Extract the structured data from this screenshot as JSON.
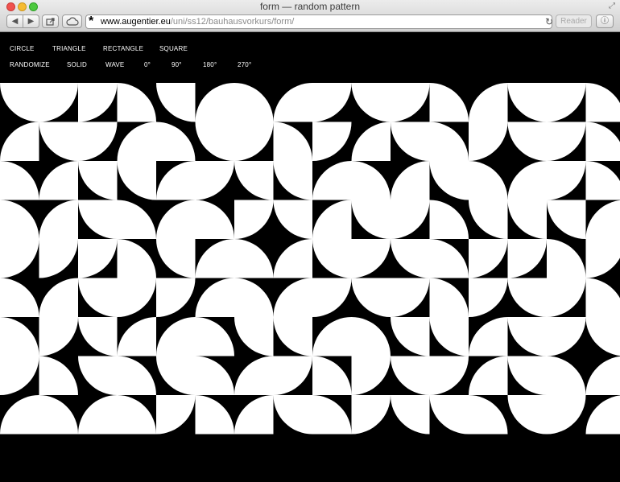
{
  "window": {
    "title": "form — random pattern"
  },
  "address_bar": {
    "host": "www.augentier.eu",
    "path": "/uni/ss12/bauhausvorkurs/form/"
  },
  "toolbar": {
    "reader_label": "Reader"
  },
  "menu": {
    "shapes": [
      "CIRCLE",
      "TRIANGLE",
      "RECTANGLE",
      "SQUARE"
    ],
    "modes": [
      "RANDOMIZE",
      "SOLID",
      "WAVE",
      "0°",
      "90°",
      "180°",
      "270°"
    ]
  },
  "pattern": {
    "colors": {
      "background": "#000000",
      "foreground": "#ffffff"
    },
    "rows": [
      "2330210132301230",
      "1231023031203230",
      "0122132210120130",
      "0120103212302221",
      "3330210123203303",
      "0123310132303230",
      "0321102210221232",
      "3020201303231201",
      "1010301203220231"
    ]
  }
}
